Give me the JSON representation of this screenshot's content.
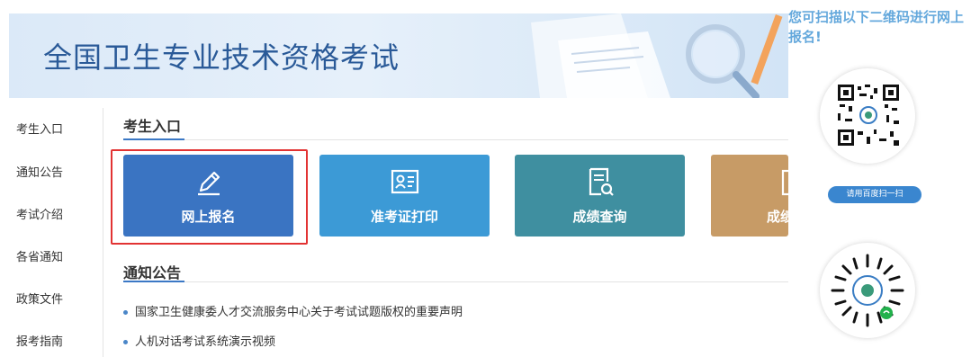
{
  "banner": {
    "title": "全国卫生专业技术资格考试"
  },
  "sidebar": {
    "items": [
      {
        "label": "考生入口"
      },
      {
        "label": "通知公告"
      },
      {
        "label": "考试介绍"
      },
      {
        "label": "各省通知"
      },
      {
        "label": "政策文件"
      },
      {
        "label": "报考指南"
      }
    ]
  },
  "entry": {
    "title": "考生入口",
    "tiles": [
      {
        "label": "网上报名",
        "icon": "pencil-edit-icon",
        "color": "#3a74c2"
      },
      {
        "label": "准考证打印",
        "icon": "id-card-icon",
        "color": "#3c9ad6"
      },
      {
        "label": "成绩查询",
        "icon": "document-search-icon",
        "color": "#3f8fa0"
      },
      {
        "label": "成绩",
        "icon": "certificate-icon",
        "color": "#c79b66"
      }
    ]
  },
  "notices": {
    "title": "通知公告",
    "items": [
      {
        "text": "国家卫生健康委人才交流服务中心关于考试试题版权的重要声明"
      },
      {
        "text": "人机对话考试系统演示视频"
      }
    ]
  },
  "right_panel": {
    "caption": "您可扫描以下二维码进行网上报名!",
    "scan_hint": "请用百度扫一扫",
    "qr_codes": [
      {
        "icon": "qr-code-icon"
      },
      {
        "icon": "mini-program-code-icon"
      }
    ]
  }
}
